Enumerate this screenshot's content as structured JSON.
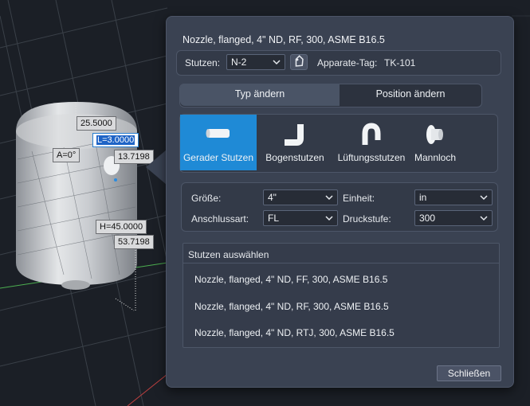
{
  "viewport": {
    "dimensions": [
      "25.5000",
      "L=3.0000",
      "A=0°",
      "13.7198",
      "H=45.0000",
      "53.7198"
    ]
  },
  "dialog": {
    "title": "Nozzle, flanged, 4\" ND, RF, 300, ASME B16.5",
    "nozzle_label": "Stutzen:",
    "nozzle_value": "N-2",
    "tag_icon": "tag-icon",
    "tag_label": "Apparate-Tag:",
    "tag_value": "TK-101",
    "tabs": [
      {
        "label": "Typ ändern",
        "active": true
      },
      {
        "label": "Position ändern",
        "active": false
      }
    ],
    "types": [
      {
        "label": "Gerader Stutzen",
        "icon": "straight-nozzle-icon",
        "selected": true
      },
      {
        "label": "Bogenstutzen",
        "icon": "bent-nozzle-icon",
        "selected": false
      },
      {
        "label": "Lüftungsstutzen",
        "icon": "vent-nozzle-icon",
        "selected": false
      },
      {
        "label": "Mannloch",
        "icon": "manhole-icon",
        "selected": false
      }
    ],
    "params": {
      "size_label": "Größe:",
      "size_value": "4\"",
      "unit_label": "Einheit:",
      "unit_value": "in",
      "conn_label": "Anschlussart:",
      "conn_value": "FL",
      "pressure_label": "Druckstufe:",
      "pressure_value": "300"
    },
    "list": {
      "header": "Stutzen auswählen",
      "items": [
        "Nozzle, flanged, 4\" ND, FF, 300, ASME B16.5",
        "Nozzle, flanged, 4\" ND, RF, 300, ASME B16.5",
        "Nozzle, flanged, 4\" ND, RTJ, 300, ASME B16.5"
      ]
    },
    "close_label": "Schließen"
  },
  "colors": {
    "dialog_bg": "#3a4252",
    "selected_tile": "#1f8ad6",
    "active_tab": "#4a5466",
    "viewport_bg": "#1b1f26"
  }
}
